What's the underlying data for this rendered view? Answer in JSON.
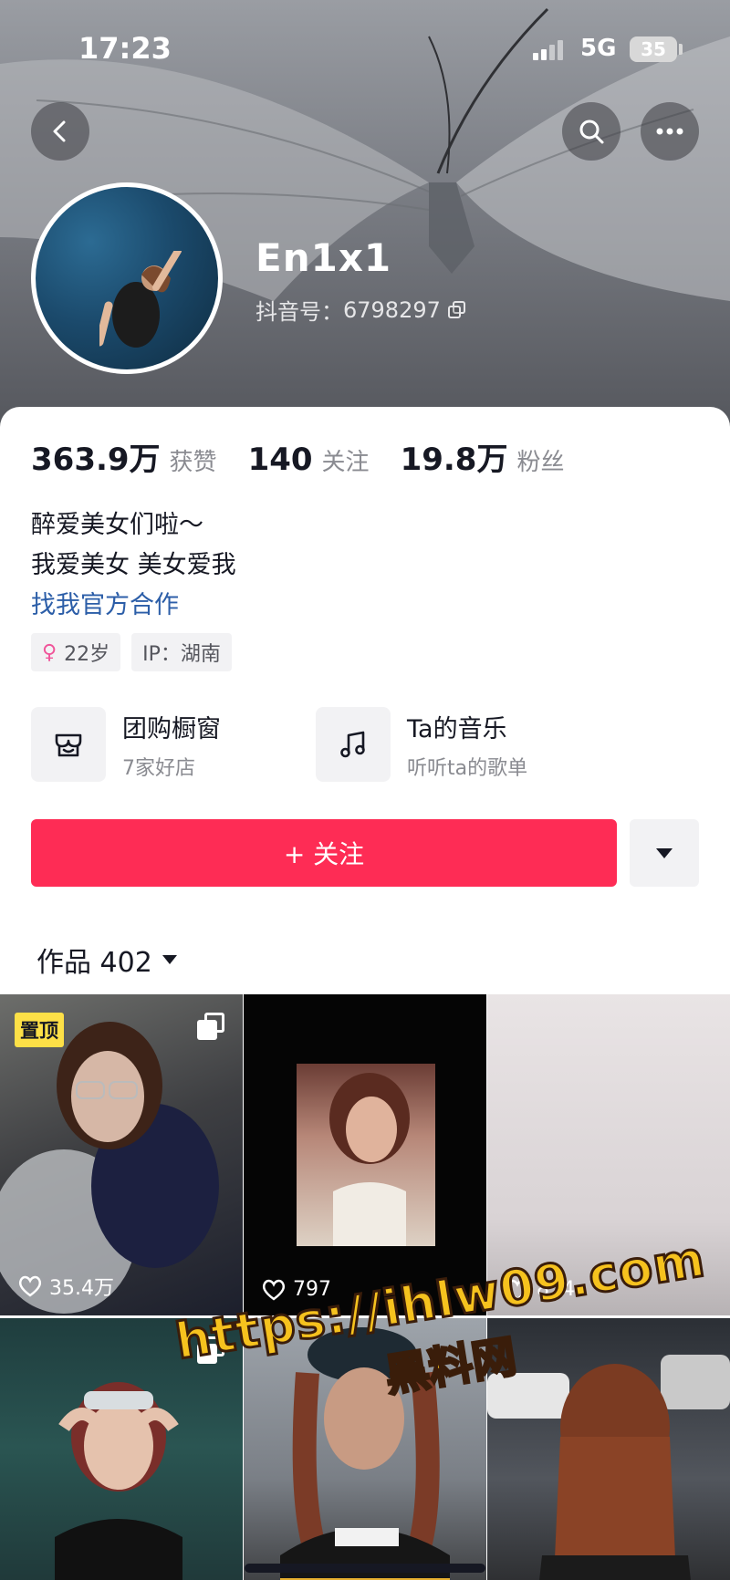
{
  "status_bar": {
    "time": "17:23",
    "network": "5G",
    "battery": "35"
  },
  "header": {
    "nickname": "En1x1",
    "douyin_id_label": "抖音号：",
    "douyin_id": "6798297",
    "back_icon": "chevron-left-icon",
    "search_icon": "search-icon",
    "more_icon": "more-dots-icon"
  },
  "stats": {
    "likes": {
      "value": "363.9万",
      "label": "获赞"
    },
    "following": {
      "value": "140",
      "label": "关注"
    },
    "followers": {
      "value": "19.8万",
      "label": "粉丝"
    }
  },
  "bio": {
    "line1": "醉爱美女们啦～",
    "line2": "我爱美女 美女爱我",
    "link": "找我官方合作"
  },
  "tags": {
    "age": "22岁",
    "ip": "IP：湖南"
  },
  "features": [
    {
      "title": "团购橱窗",
      "subtitle": "7家好店",
      "icon": "shop-icon"
    },
    {
      "title": "Ta的音乐",
      "subtitle": "听听ta的歌单",
      "icon": "music-note-icon"
    }
  ],
  "follow_button": {
    "label": "+ 关注"
  },
  "works_tab": {
    "label": "作品 402"
  },
  "videos": [
    {
      "likes": "35.4万",
      "pinned": true,
      "pin_label": "置顶",
      "multi": true
    },
    {
      "likes": "797",
      "pinned": false,
      "multi": false
    },
    {
      "likes": "824",
      "pinned": false,
      "multi": false
    },
    {
      "likes": "",
      "pinned": false,
      "multi": true
    },
    {
      "likes": "",
      "pinned": false,
      "multi": false
    },
    {
      "likes": "",
      "pinned": false,
      "multi": false
    }
  ],
  "watermark": {
    "url": "https://ihlw09.com",
    "name": "黑料网"
  },
  "colors": {
    "accent": "#fe2c55",
    "link": "#2c5ea8",
    "pin_badge": "#fde047",
    "watermark": "#f6c21e"
  }
}
